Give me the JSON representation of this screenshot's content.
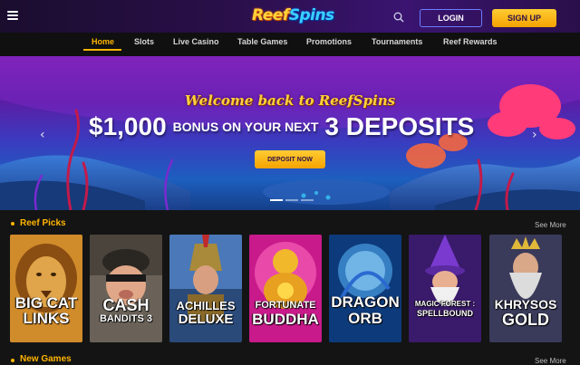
{
  "header": {
    "logo": {
      "part1": "Reef",
      "part2": "Spins"
    },
    "login_label": "LOGIN",
    "signup_label": "SIGN UP"
  },
  "nav": {
    "items": [
      "Home",
      "Slots",
      "Live Casino",
      "Table Games",
      "Promotions",
      "Tournaments",
      "Reef Rewards"
    ],
    "active": "Home"
  },
  "hero": {
    "welcome": "Welcome back to ReefSpins",
    "amount": "$1,000",
    "bonus_text": "BONUS ON YOUR NEXT",
    "deposits": "3 DEPOSITS",
    "cta_label": "DEPOSIT NOW",
    "slide_count": 3,
    "active_slide": 1
  },
  "sections": {
    "reef_picks": {
      "title": "Reef Picks",
      "see_more": "See More"
    },
    "new_games": {
      "title": "New Games",
      "see_more": "See More"
    }
  },
  "games": [
    {
      "line1": "BIG CAT",
      "line2": "LINKS"
    },
    {
      "line1": "CASH",
      "line2": "BANDITS 3"
    },
    {
      "line1": "ACHILLES",
      "line2": "DELUXE"
    },
    {
      "line1": "FORTUNATE",
      "line2": "BUDDHA"
    },
    {
      "line1": "DRAGON",
      "line2": "ORB"
    },
    {
      "line1": "MAGIC FOREST :",
      "line2": "SPELLBOUND"
    },
    {
      "line1": "KHRYSOS",
      "line2": "GOLD"
    }
  ],
  "colors": {
    "accent": "#ffb400",
    "header_bg": "#2a0f4a",
    "page_bg": "#141414",
    "login_border": "#6b7cff"
  }
}
